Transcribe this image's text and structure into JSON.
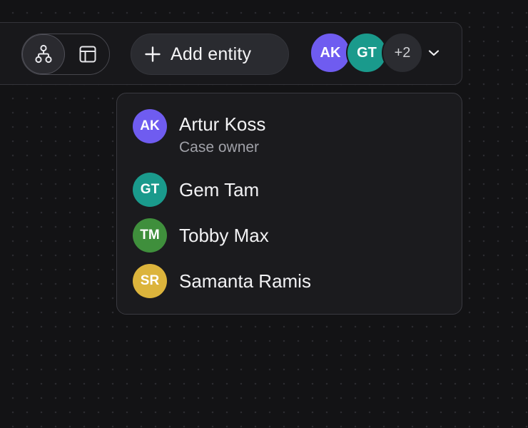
{
  "toolbar": {
    "view_toggle": {
      "options": [
        {
          "icon": "graph-view-icon",
          "active": true
        },
        {
          "icon": "table-view-icon",
          "active": false
        }
      ]
    },
    "add_entity_label": "Add entity",
    "avatars": [
      {
        "initials": "AK",
        "color": "#6f5cf0"
      },
      {
        "initials": "GT",
        "color": "#1a9a8c"
      }
    ],
    "more_count": "+2",
    "expand_icon": "chevron-down-icon"
  },
  "members_dropdown": {
    "members": [
      {
        "initials": "AK",
        "name": "Artur Koss",
        "role": "Case owner",
        "color": "#6f5cf0"
      },
      {
        "initials": "GT",
        "name": "Gem Tam",
        "role": "",
        "color": "#1a9a8c"
      },
      {
        "initials": "TM",
        "name": "Tobby Max",
        "role": "",
        "color": "#3f8f3c"
      },
      {
        "initials": "SR",
        "name": "Samanta Ramis",
        "role": "",
        "color": "#dcb43c"
      }
    ]
  },
  "colors": {
    "background": "#131315",
    "panel": "#18181b",
    "button": "#2a2b30",
    "text": "#f2f2f4",
    "muted_text": "#a0a1a8"
  }
}
